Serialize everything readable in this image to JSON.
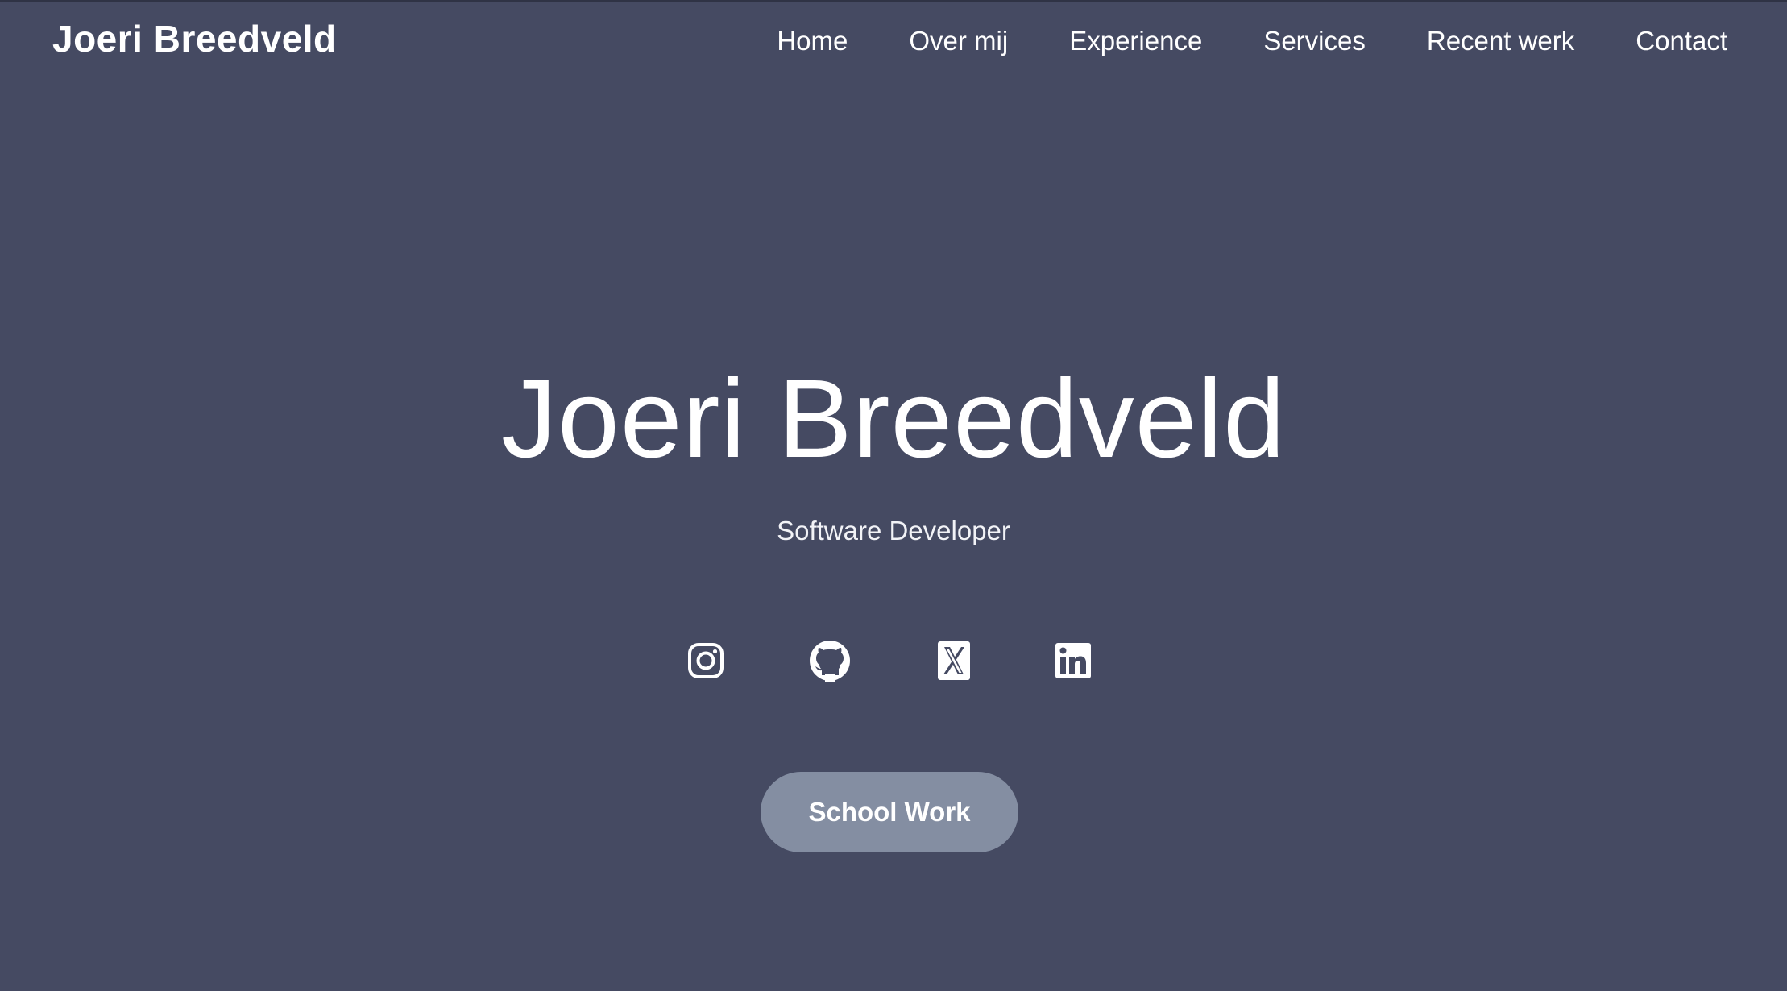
{
  "header": {
    "brand": "Joeri Breedveld",
    "nav": [
      {
        "label": "Home"
      },
      {
        "label": "Over mij"
      },
      {
        "label": "Experience"
      },
      {
        "label": "Services"
      },
      {
        "label": "Recent werk"
      },
      {
        "label": "Contact"
      }
    ]
  },
  "hero": {
    "title": "Joeri Breedveld",
    "subtitle": "Software Developer",
    "socials": [
      {
        "icon": "instagram-icon"
      },
      {
        "icon": "github-icon"
      },
      {
        "icon": "x-twitter-icon"
      },
      {
        "icon": "linkedin-icon"
      }
    ],
    "cta_label": "School Work"
  },
  "colors": {
    "background": "#454a62",
    "button": "#848ea2",
    "text": "#ffffff"
  }
}
